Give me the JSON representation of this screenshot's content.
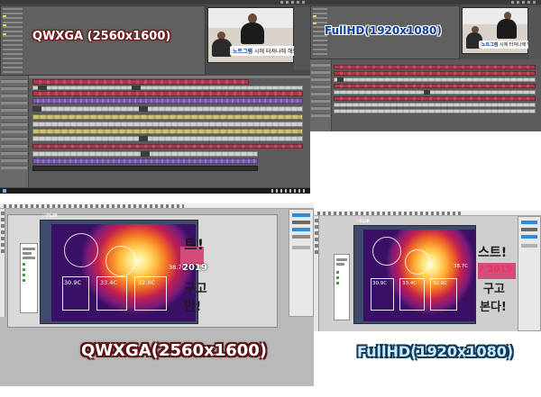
{
  "panels": {
    "top_left": {
      "resolution_label": "QWXGA (2560x1600)"
    },
    "top_right": {
      "resolution_label": "FullHD(1920x1080)"
    },
    "bottom_left": {
      "resolution_label": "QWXGA(2560x1600)"
    },
    "bottom_right": {
      "resolution_label": "FullHD(1920x1080)"
    }
  },
  "thermal": {
    "left": {
      "temps": [
        "38.7C",
        "30.9C",
        "33.4C",
        "32.0C"
      ],
      "logo": "☉FLIR"
    },
    "right": {
      "temps": [
        "38.7C",
        "30.9C",
        "33.4C",
        "32.0C"
      ],
      "logo": "☉FLIR"
    }
  },
  "promo": {
    "left": {
      "l1": "트!",
      "l2": "2019",
      "l3": "구고",
      "l4": "만!"
    },
    "right": {
      "l1": "스트!",
      "l2": "7 2019",
      "l3": "구고",
      "l4": "본다!"
    }
  },
  "preview": {
    "caption_prefix": "노트그램",
    "caption_text": "시에 터져나에 해보세요"
  },
  "colors": {
    "clip_red": "#a83a4b",
    "clip_yellow": "#c9c07a",
    "clip_purple": "#7a5bb0",
    "label_outline_red": "#6b1a1a",
    "label_blue": "#0c3f9a"
  },
  "icons": {
    "taskbar_start": "windows-logo-icon",
    "thermal_logo": "flir-logo-icon"
  }
}
